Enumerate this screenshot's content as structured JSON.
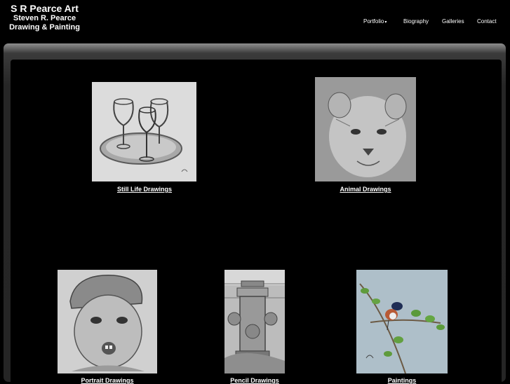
{
  "site": {
    "title": "S R Pearce Art",
    "artist": "Steven R. Pearce",
    "subtitle": "Drawing & Painting"
  },
  "nav": {
    "portfolio": "Portfolio",
    "portfolio_caret": "▾",
    "biography": "Biography",
    "galleries": "Galleries",
    "contact": "Contact"
  },
  "gallery": {
    "still_life": "Still Life Drawings",
    "animal": "Animal Drawings",
    "portrait": "Portrait Drawings",
    "pencil": "Pencil Drawings",
    "paintings": "Paintings"
  },
  "colors": {
    "background": "#000000",
    "text": "#ffffff",
    "frame": "#2a2a2a"
  }
}
